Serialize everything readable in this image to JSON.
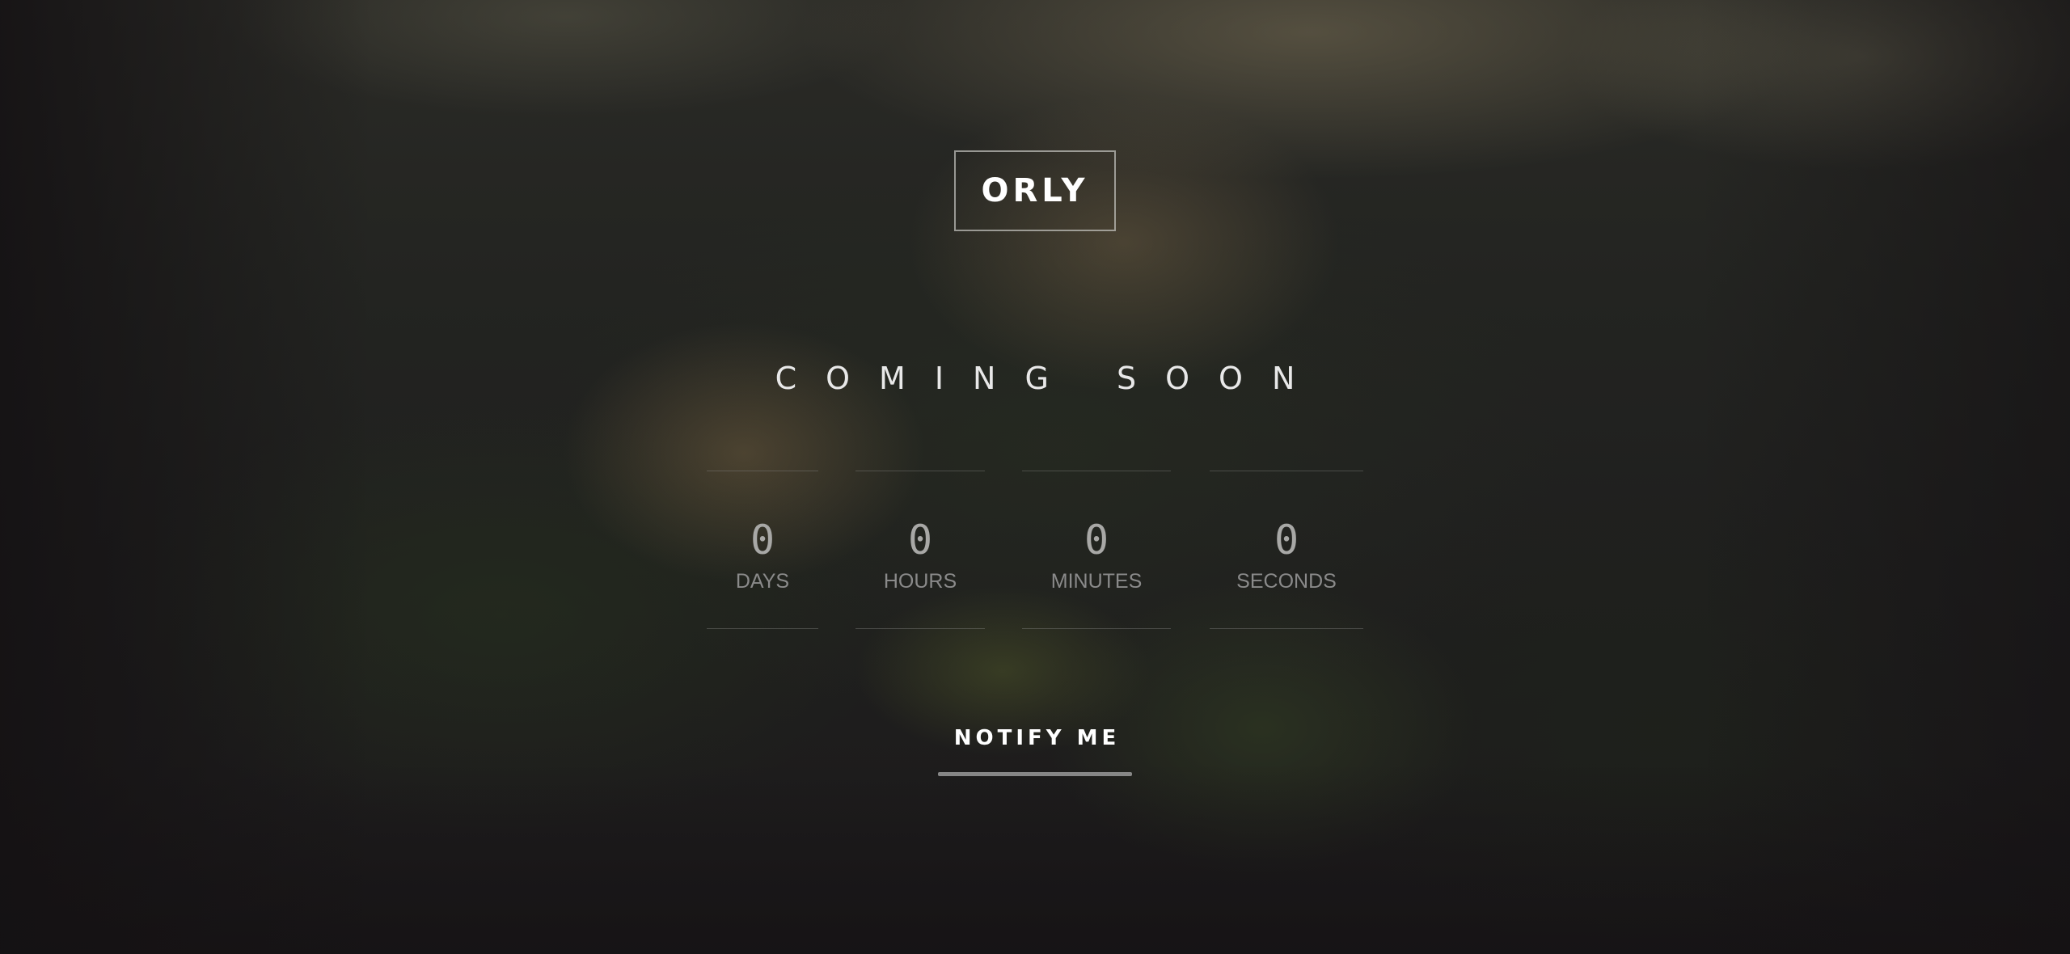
{
  "brand": {
    "logo_text": "ORLY"
  },
  "hero": {
    "headline": "COMING SOON"
  },
  "countdown": [
    {
      "value": "0",
      "label": "DAYS"
    },
    {
      "value": "0",
      "label": "HOURS"
    },
    {
      "value": "0",
      "label": "MINUTES"
    },
    {
      "value": "0",
      "label": "SECONDS"
    }
  ],
  "cta": {
    "notify_label": "NOTIFY ME"
  },
  "colors": {
    "text": "#ffffff",
    "muted": "#8a8a8a",
    "background": "#1c1a1b"
  }
}
